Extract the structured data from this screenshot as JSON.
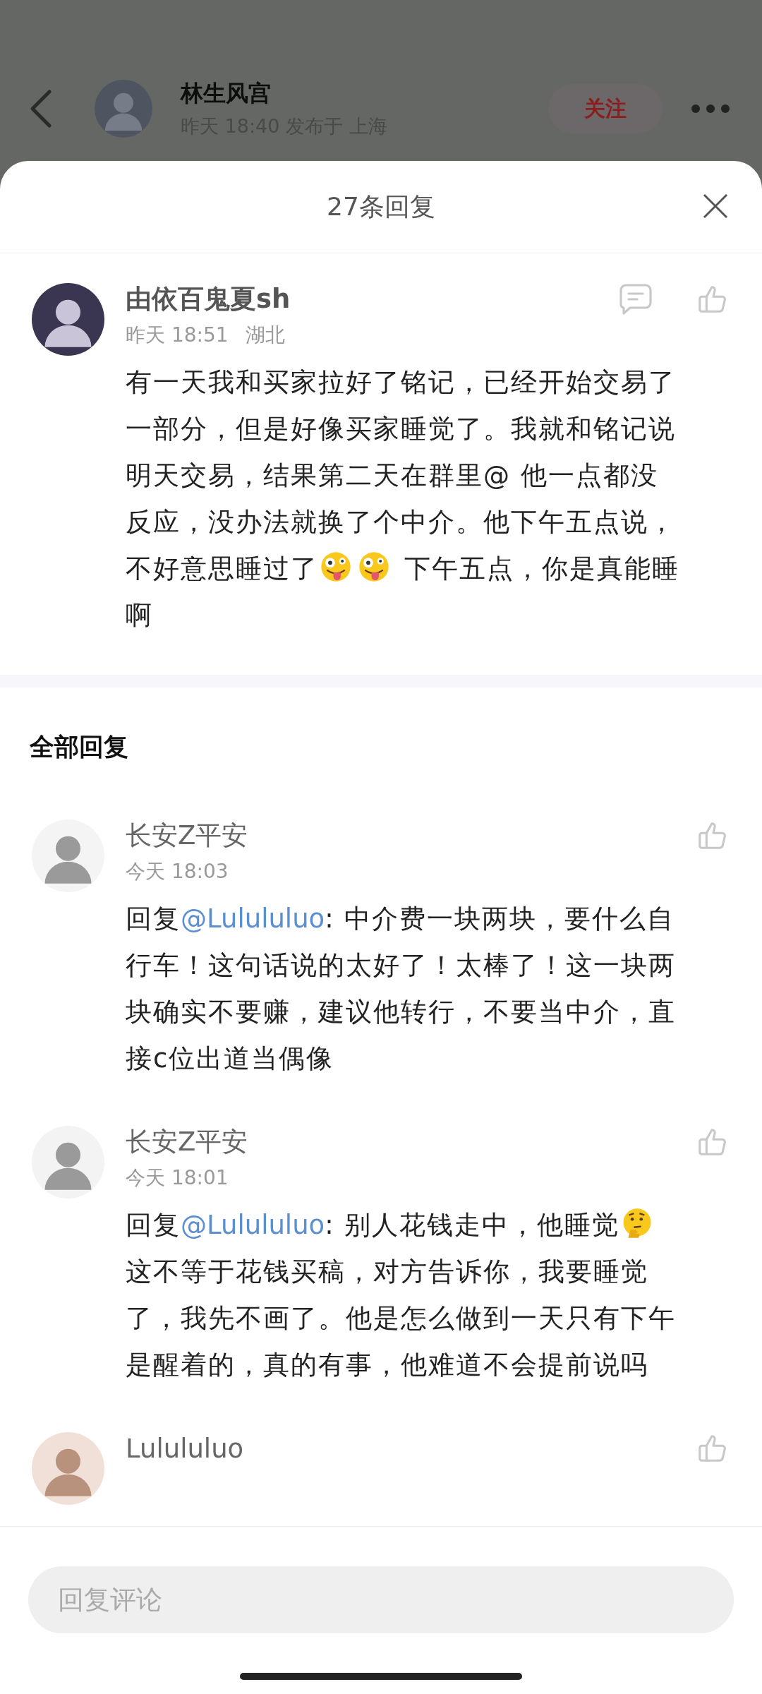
{
  "post_header": {
    "author": "林生风宫",
    "meta": "昨天 18:40 发布于 上海",
    "follow_button": "关注"
  },
  "sheet": {
    "title": "27条回复"
  },
  "main_comment": {
    "name": "由依百鬼夏sh",
    "time": "昨天 18:51",
    "location": "湖北",
    "body": [
      {
        "kind": "text",
        "text": "有一天我和买家拉好了铭记，已经开始交易了一部分，但是好像买家睡觉了。我就和铭记说明天交易，结果第二天在群里@ 他一点都没反应，没办法就换了个中介。他下午五点说，不好意思睡过了"
      },
      {
        "kind": "zany_emoji"
      },
      {
        "kind": "zany_emoji"
      },
      {
        "kind": "text",
        "text": " 下午五点，你是真能睡啊"
      }
    ]
  },
  "section_title": "全部回复",
  "replies": [
    {
      "name": "长安Z平安",
      "time": "今天 18:03",
      "body": [
        {
          "kind": "text",
          "text": "回复"
        },
        {
          "kind": "mention",
          "text": "@Lulululuo"
        },
        {
          "kind": "text",
          "text": ": 中介费一块两块，要什么自行车！这句话说的太好了！太棒了！这一块两块确实不要赚，建议他转行，不要当中介，直接c位出道当偶像"
        }
      ]
    },
    {
      "name": "长安Z平安",
      "time": "今天 18:01",
      "body": [
        {
          "kind": "text",
          "text": "回复"
        },
        {
          "kind": "mention",
          "text": "@Lulululuo"
        },
        {
          "kind": "text",
          "text": ": 别人花钱走中，他睡觉"
        },
        {
          "kind": "thinking_emoji"
        },
        {
          "kind": "text",
          "text": "这不等于花钱买稿，对方告诉你，我要睡觉了，我先不画了。他是怎么做到一天只有下午是醒着的，真的有事，他难道不会提前说吗"
        }
      ]
    },
    {
      "name": "Lulululuo"
    }
  ],
  "reply_input": {
    "placeholder": "回复评论"
  }
}
